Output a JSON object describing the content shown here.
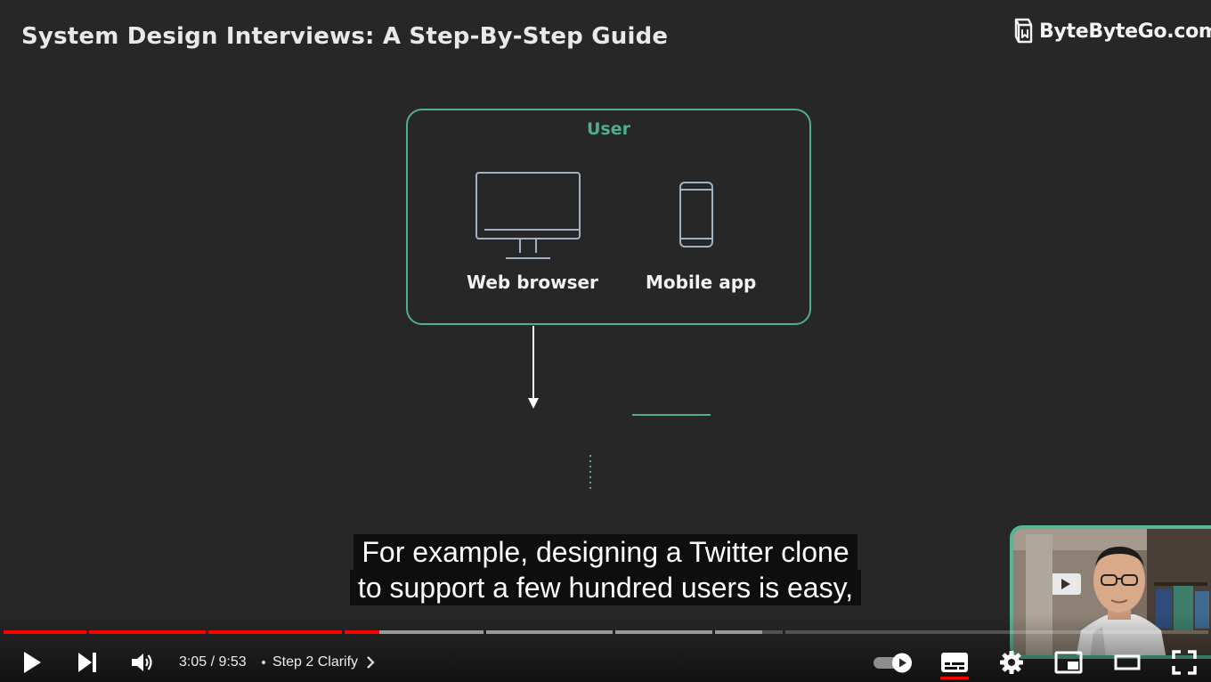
{
  "slide": {
    "title": "System Design Interviews: A Step-By-Step Guide",
    "brand": "ByteByteGo.com",
    "user_box_label": "User",
    "devices": [
      {
        "label": "Web browser",
        "icon": "monitor-icon"
      },
      {
        "label": "Mobile app",
        "icon": "smartphone-icon"
      }
    ],
    "accent_color": "#4fae8b"
  },
  "captions": {
    "line1": "For example, designing a Twitter clone",
    "line2": "to support a few hundred users is easy,"
  },
  "player": {
    "current_time": "3:05",
    "duration": "9:53",
    "time_separator": " / ",
    "chapter_label": "Step 2 Clarify",
    "played_fraction": 0.312,
    "buffered_fraction": 0.63,
    "chapter_segments": 8,
    "controls": [
      "play-icon",
      "next-icon",
      "volume-icon",
      "autoplay-toggle",
      "subtitles-icon",
      "settings-icon",
      "miniplayer-icon",
      "theater-mode-icon",
      "fullscreen-icon"
    ],
    "progress_color": "#ff0000",
    "subtitles_enabled": true,
    "autoplay_on": true
  }
}
